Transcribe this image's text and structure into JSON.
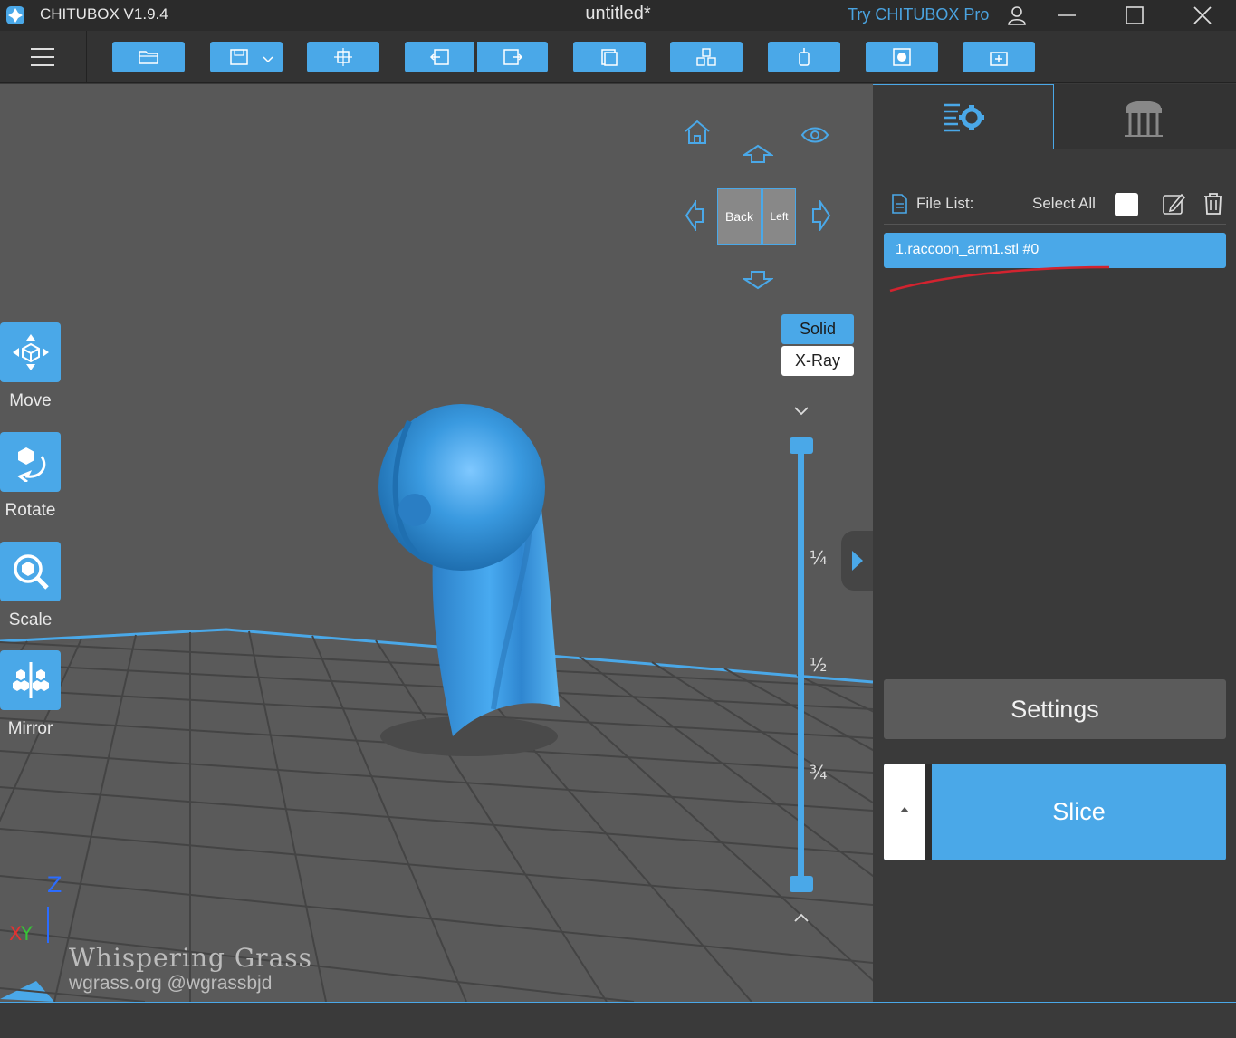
{
  "app": {
    "name": "CHITUBOX V1.9.4",
    "document_title": "untitled*",
    "pro_link": "Try CHITUBOX Pro"
  },
  "icons": {
    "logo": "chitubox-logo-icon",
    "user": "user-icon",
    "minimize": "minimize-icon",
    "maximize": "maximize-icon",
    "close": "close-icon",
    "menu": "hamburger-menu-icon",
    "open": "folder-open-icon",
    "save": "save-icon",
    "slice_model": "slice-model-icon",
    "undo": "undo-icon",
    "redo": "redo-icon",
    "copy": "copy-icon",
    "arrange": "auto-arrange-icon",
    "support": "support-icon",
    "hollow": "hollow-icon",
    "add_box": "add-box-icon"
  },
  "tools": [
    {
      "label": "Move",
      "icon": "move-icon"
    },
    {
      "label": "Rotate",
      "icon": "rotate-icon"
    },
    {
      "label": "Scale",
      "icon": "scale-icon"
    },
    {
      "label": "Mirror",
      "icon": "mirror-icon"
    }
  ],
  "view_cube": {
    "back": "Back",
    "left": "Left"
  },
  "render_modes": {
    "solid": "Solid",
    "xray": "X-Ray",
    "selected": "Solid"
  },
  "layer_slider": {
    "q1": "¼",
    "q2": "½",
    "q3": "¾"
  },
  "axes": {
    "z": "Z",
    "x": "X",
    "y": "Y"
  },
  "watermark": {
    "line1": "Whispering Grass",
    "line2": "wgrass.org @wgrassbjd"
  },
  "panel": {
    "tabs": [
      {
        "icon": "settings-list-icon"
      },
      {
        "icon": "printer-platform-icon"
      }
    ],
    "file_list_label": "File List:",
    "select_all": "Select All",
    "files": [
      "1.raccoon_arm1.stl #0"
    ],
    "settings_button": "Settings",
    "slice_button": "Slice"
  },
  "colors": {
    "accent": "#4aa8e8",
    "model": "#3f9de0",
    "background": "#3a3a3a"
  }
}
